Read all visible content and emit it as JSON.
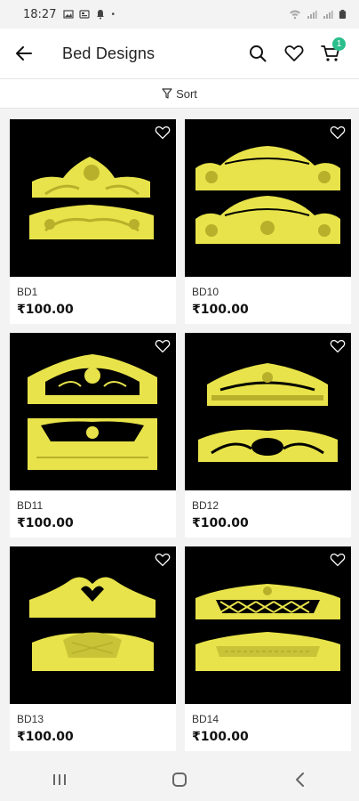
{
  "status_bar": {
    "time": "18:27",
    "dot": "•"
  },
  "header": {
    "title": "Bed Designs",
    "back_icon": "arrow-left-icon",
    "search_icon": "search-icon",
    "wishlist_icon": "heart-icon",
    "cart_icon": "cart-icon",
    "cart_count": "1",
    "accent": "#2bbf8e"
  },
  "sort": {
    "label": "Sort",
    "icon": "filter-icon"
  },
  "colors": {
    "gold": "#e8e34a",
    "gold_dark": "#b8b02a",
    "thumb_bg": "#000000"
  },
  "products": [
    {
      "name": "BD1",
      "price": "₹100.00",
      "variant": "crown-a"
    },
    {
      "name": "BD10",
      "price": "₹100.00",
      "variant": "scroll-b"
    },
    {
      "name": "BD11",
      "price": "₹100.00",
      "variant": "arch-c"
    },
    {
      "name": "BD12",
      "price": "₹100.00",
      "variant": "wing-d"
    },
    {
      "name": "BD13",
      "price": "₹100.00",
      "variant": "heart-e"
    },
    {
      "name": "BD14",
      "price": "₹100.00",
      "variant": "lattice-f"
    }
  ]
}
